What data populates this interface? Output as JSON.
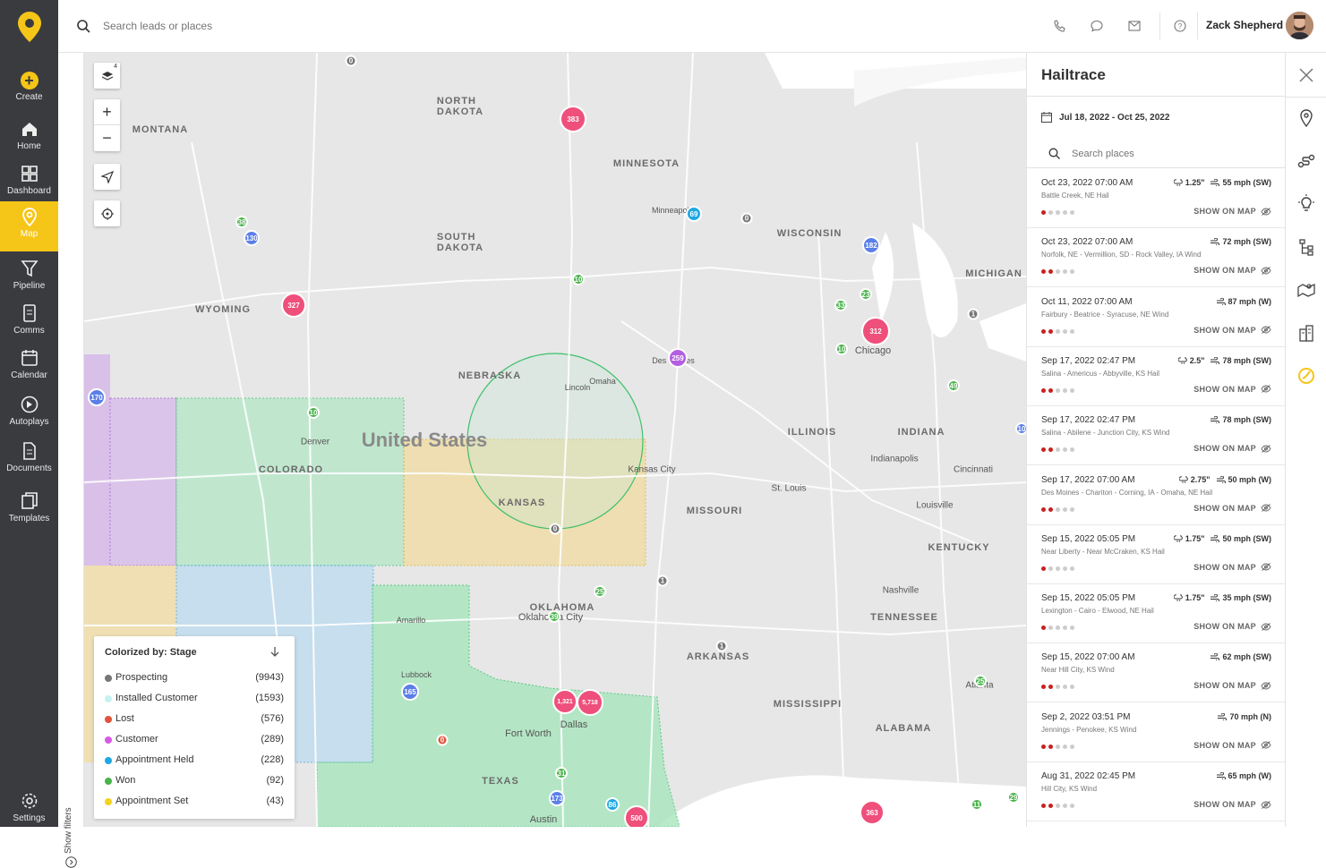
{
  "sidebar": {
    "items": [
      {
        "label": "Create",
        "icon": "plus-icon"
      },
      {
        "label": "Home",
        "icon": "home-icon"
      },
      {
        "label": "Dashboard",
        "icon": "dashboard-icon"
      },
      {
        "label": "Map",
        "icon": "map-pin-icon",
        "active": true
      },
      {
        "label": "Pipeline",
        "icon": "funnel-icon"
      },
      {
        "label": "Comms",
        "icon": "comms-icon"
      },
      {
        "label": "Calendar",
        "icon": "calendar-icon"
      },
      {
        "label": "Autoplays",
        "icon": "autoplay-icon"
      },
      {
        "label": "Documents",
        "icon": "document-icon"
      },
      {
        "label": "Templates",
        "icon": "templates-icon"
      },
      {
        "label": "Settings",
        "icon": "gear-icon"
      }
    ]
  },
  "topbar": {
    "search_placeholder": "Search leads or places",
    "user_name": "Zack Shepherd"
  },
  "map": {
    "show_filters_label": "Show filters",
    "layers_badge": "4",
    "country_label": "United States",
    "clusters": [
      "383",
      "69",
      "182",
      "23",
      "33",
      "312",
      "10",
      "259",
      "327",
      "130",
      "38",
      "170",
      "10",
      "10",
      "25",
      "39",
      "165",
      "1,321",
      "5,718",
      "31",
      "173",
      "86",
      "500",
      "363",
      "11",
      "29",
      "25",
      "49",
      "0",
      "0",
      "0",
      "1",
      "1",
      "1",
      "0",
      "10"
    ]
  },
  "legend": {
    "title": "Colorized by: Stage",
    "rows": [
      {
        "label": "Prospecting",
        "count": "(9943)",
        "color": "#777777"
      },
      {
        "label": "Installed Customer",
        "count": "(1593)",
        "color": "#c6f2f2"
      },
      {
        "label": "Lost",
        "count": "(576)",
        "color": "#e2533b"
      },
      {
        "label": "Customer",
        "count": "(289)",
        "color": "#d65be3"
      },
      {
        "label": "Appointment Held",
        "count": "(228)",
        "color": "#1ea8e3"
      },
      {
        "label": "Won",
        "count": "(92)",
        "color": "#48b34a"
      },
      {
        "label": "Appointment Set",
        "count": "(43)",
        "color": "#f5d21c"
      }
    ]
  },
  "panel": {
    "title": "Hailtrace",
    "date_range": "Jul 18, 2022 - Oct 25, 2022",
    "search_placeholder": "Search places",
    "show_on_map_label": "SHOW ON MAP",
    "events": [
      {
        "date": "Oct 23, 2022 07:00 AM",
        "hail": "1.25\"",
        "wind": "55 mph (SW)",
        "place": "Battle Creek, NE Hail",
        "severity": 1
      },
      {
        "date": "Oct 23, 2022 07:00 AM",
        "hail": "",
        "wind": "72 mph (SW)",
        "place": "Norfolk, NE - Vermillion, SD - Rock Valley, IA Wind",
        "severity": 2
      },
      {
        "date": "Oct 11, 2022 07:00 AM",
        "hail": "",
        "wind": "87 mph (W)",
        "place": "Fairbury - Beatrice - Syracuse, NE Wind",
        "severity": 2
      },
      {
        "date": "Sep 17, 2022 02:47 PM",
        "hail": "2.5\"",
        "wind": "78 mph (SW)",
        "place": "Salina - Americus - Abbyville, KS Hail",
        "severity": 2
      },
      {
        "date": "Sep 17, 2022 02:47 PM",
        "hail": "",
        "wind": "78 mph (SW)",
        "place": "Salina - Abilene - Junction City, KS Wind",
        "severity": 2
      },
      {
        "date": "Sep 17, 2022 07:00 AM",
        "hail": "2.75\"",
        "wind": "50 mph (W)",
        "place": "Des Moines - Chariton - Corning, IA - Omaha, NE Hail",
        "severity": 2
      },
      {
        "date": "Sep 15, 2022 05:05 PM",
        "hail": "1.75\"",
        "wind": "50 mph (SW)",
        "place": "Near Liberty - Near McCraken, KS Hail",
        "severity": 1
      },
      {
        "date": "Sep 15, 2022 05:05 PM",
        "hail": "1.75\"",
        "wind": "35 mph (SW)",
        "place": "Lexington - Cairo - Elwood, NE Hail",
        "severity": 1
      },
      {
        "date": "Sep 15, 2022 07:00 AM",
        "hail": "",
        "wind": "62 mph (SW)",
        "place": "Near Hill City, KS Wind",
        "severity": 2
      },
      {
        "date": "Sep 2, 2022 03:51 PM",
        "hail": "",
        "wind": "70 mph (N)",
        "place": "Jennings - Penokee, KS Wind",
        "severity": 2
      },
      {
        "date": "Aug 31, 2022 02:45 PM",
        "hail": "",
        "wind": "65 mph (W)",
        "place": "Hill City, KS Wind",
        "severity": 2
      }
    ]
  }
}
